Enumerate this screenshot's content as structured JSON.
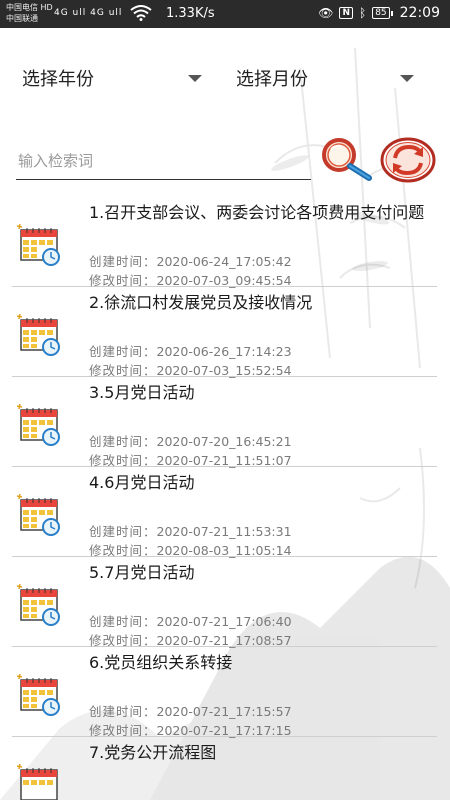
{
  "status_bar": {
    "carrier_1": "中国电信 HD",
    "carrier_2": "中国联通",
    "signal": "4G ull 4G ull",
    "net_speed": "1.33K/s",
    "battery": "85",
    "time": "22:09"
  },
  "filters": {
    "year_label": "选择年份",
    "month_label": "选择月份"
  },
  "search": {
    "placeholder": "输入检索词",
    "value": ""
  },
  "labels": {
    "created": "创建时间：",
    "modified": "修改时间："
  },
  "items": [
    {
      "title": "1.召开支部会议、两委会讨论各项费用支付问题",
      "created": "2020-06-24_17:05:42",
      "modified": "2020-07-03_09:45:54"
    },
    {
      "title": "2.徐流口村发展党员及接收情况",
      "created": "2020-06-26_17:14:23",
      "modified": "2020-07-03_15:52:54"
    },
    {
      "title": "3.5月党日活动",
      "created": "2020-07-20_16:45:21",
      "modified": "2020-07-21_11:51:07"
    },
    {
      "title": "4.6月党日活动",
      "created": "2020-07-21_11:53:31",
      "modified": "2020-08-03_11:05:14"
    },
    {
      "title": "5.7月党日活动",
      "created": "2020-07-21_17:06:40",
      "modified": "2020-07-21_17:08:57"
    },
    {
      "title": "6.党员组织关系转接",
      "created": "2020-07-21_17:15:57",
      "modified": "2020-07-21_17:17:15"
    },
    {
      "title": "7.党务公开流程图",
      "created": "",
      "modified": ""
    }
  ]
}
